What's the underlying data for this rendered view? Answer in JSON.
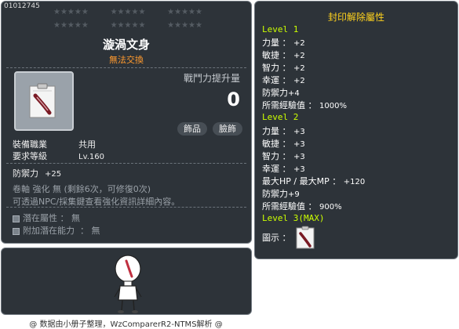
{
  "item_id": "01012745",
  "header": {
    "stars_group": "★★★★★",
    "name": "漩渦文身",
    "trade_status": "無法交換"
  },
  "stat_panel": {
    "label": "戰鬥力提升量",
    "value": "0",
    "tags": [
      "飾品",
      "臉飾"
    ]
  },
  "requirements": {
    "job_label": "裝備職業",
    "job_value": "共用",
    "level_label": "要求等級",
    "level_value": "Lv.160"
  },
  "defense": {
    "label": "防禦力",
    "value": "+25"
  },
  "scroll_line": "卷軸 強化 無 (剩餘6次，可修復0次)",
  "npc_line": "可透過NPC/採集鍵查看強化資訊詳細內容。",
  "potential": [
    {
      "label": "潛在屬性",
      "value": "： 無"
    },
    {
      "label": "附加潛在能力",
      "value": "： 無"
    }
  ],
  "footer": "@ 数据由小册子整理，WzComparerR2-NTMS解析 @",
  "seal": {
    "title": "封印解除屬性",
    "level1": {
      "label": "Level 1",
      "stats": [
        {
          "name": "力量 ： ",
          "value": "+2"
        },
        {
          "name": "敏捷 ： ",
          "value": "+2"
        },
        {
          "name": "智力 ： ",
          "value": "+2"
        },
        {
          "name": "幸運 ： ",
          "value": "+2"
        },
        {
          "name": "防禦力",
          "value": "+4"
        },
        {
          "name": "所需經驗值 ： ",
          "value": "1000%"
        }
      ]
    },
    "level2": {
      "label": "Level 2",
      "stats": [
        {
          "name": "力量 ： ",
          "value": "+3"
        },
        {
          "name": "敏捷 ： ",
          "value": "+3"
        },
        {
          "name": "智力 ： ",
          "value": "+3"
        },
        {
          "name": "幸運 ： ",
          "value": "+3"
        },
        {
          "name": "最大HP / 最大MP ： ",
          "value": "+120"
        },
        {
          "name": "防禦力",
          "value": "+9"
        },
        {
          "name": "所需經驗值 ： ",
          "value": "900%"
        }
      ]
    },
    "level3_label": "Level 3(MAX)",
    "figure_label": "圖示 ："
  },
  "colors": {
    "panel_bg": "#2d3339",
    "trade_orange": "#ff9a2e",
    "level_green": "#ccff00",
    "seal_title_yellow": "#ffd21d"
  }
}
